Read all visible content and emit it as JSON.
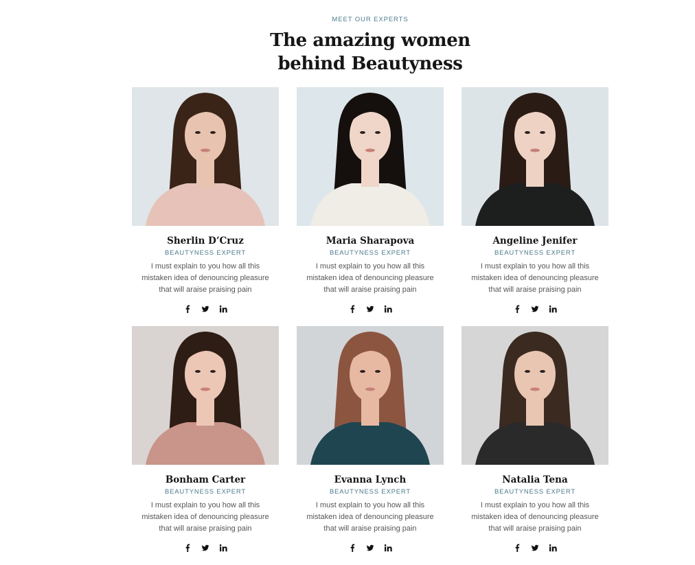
{
  "header": {
    "eyebrow": "MEET OUR EXPERTS",
    "title": "The amazing women behind Beautyness"
  },
  "experts": [
    {
      "name": "Sherlin D’Cruz",
      "role": "BEAUTYNESS EXPERT",
      "bio": "I must explain to you how all this mistaken idea of denouncing pleasure that will araise praising pain",
      "photo": {
        "bg": "#dfe5e8",
        "hair": "#3a2418",
        "skin": "#e8c3b0",
        "top": "#e6c2b8"
      }
    },
    {
      "name": "Maria Sharapova",
      "role": "BEAUTYNESS EXPERT",
      "bio": "I must explain to you how all this mistaken idea of denouncing pleasure that will araise praising pain",
      "photo": {
        "bg": "#dde6ea",
        "hair": "#15100d",
        "skin": "#efd6c8",
        "top": "#f0ece6"
      }
    },
    {
      "name": "Angeline Jenifer",
      "role": "BEAUTYNESS EXPERT",
      "bio": "I must explain to you how all this mistaken idea of denouncing pleasure that will araise praising pain",
      "photo": {
        "bg": "#dde4e8",
        "hair": "#2a1c15",
        "skin": "#eed3c5",
        "top": "#1d1f1f"
      }
    },
    {
      "name": "Bonham Carter",
      "role": "BEAUTYNESS EXPERT",
      "bio": "I must explain to you how all this mistaken idea of denouncing pleasure that will araise praising pain",
      "photo": {
        "bg": "#d9d4d1",
        "hair": "#2e1d15",
        "skin": "#ecc7b5",
        "top": "#c9948a"
      }
    },
    {
      "name": "Evanna Lynch",
      "role": "BEAUTYNESS EXPERT",
      "bio": "I must explain to you how all this mistaken idea of denouncing pleasure that will araise praising pain",
      "photo": {
        "bg": "#d2d5d8",
        "hair": "#8c5540",
        "skin": "#e7b9a3",
        "top": "#1f4550"
      }
    },
    {
      "name": "Natalia Tena",
      "role": "BEAUTYNESS EXPERT",
      "bio": "I must explain to you how all this mistaken idea of denouncing pleasure that will araise praising pain",
      "photo": {
        "bg": "#d6d6d6",
        "hair": "#3b2a20",
        "skin": "#e9c6b2",
        "top": "#2a2a2a"
      }
    }
  ],
  "social_icons": [
    "facebook-icon",
    "twitter-icon",
    "linkedin-icon"
  ],
  "colors": {
    "accent": "#4d7a8c",
    "heading": "#161616",
    "body": "#555555"
  }
}
